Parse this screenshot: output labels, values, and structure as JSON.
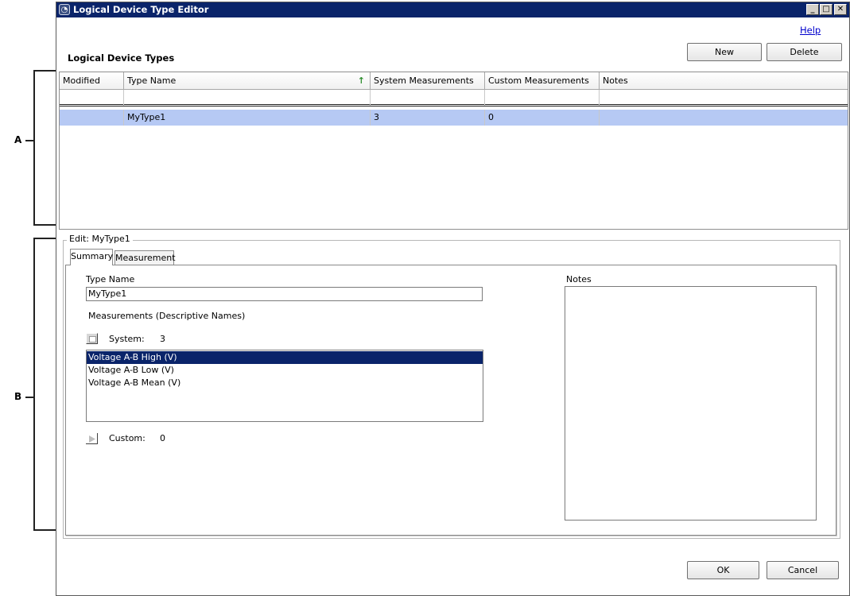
{
  "callouts": {
    "a": "A",
    "b": "B"
  },
  "window": {
    "title": "Logical Device Type Editor",
    "controls": {
      "minimize": "_",
      "maximize": "□",
      "close": "✕"
    }
  },
  "header": {
    "help": "Help",
    "section_title": "Logical Device Types"
  },
  "toolbar": {
    "new_label": "New",
    "delete_label": "Delete"
  },
  "grid": {
    "columns": [
      "Modified",
      "Type Name",
      "System Measurements",
      "Custom Measurements",
      "Notes"
    ],
    "sort_icon": "↑",
    "rows": [
      {
        "modified": "",
        "type_name": "MyType1",
        "system": "3",
        "custom": "0",
        "notes": ""
      }
    ]
  },
  "edit": {
    "group_label": "Edit: MyType1",
    "tabs": [
      "Summary",
      "Measurement"
    ],
    "type_name_label": "Type Name",
    "type_name_value": "MyType1",
    "measurements_label": "Measurements (Descriptive Names)",
    "system_label": "System:",
    "system_count": "3",
    "system_items": [
      "Voltage A-B High (V)",
      "Voltage A-B Low (V)",
      "Voltage A-B Mean (V)"
    ],
    "custom_label": "Custom:",
    "custom_count": "0",
    "notes_label": "Notes"
  },
  "footer": {
    "ok_label": "OK",
    "cancel_label": "Cancel"
  },
  "colors": {
    "titlebar": "#0a246a",
    "selection_row": "#b6c9f4",
    "selection_list": "#0a246a",
    "link": "#0000cc"
  }
}
